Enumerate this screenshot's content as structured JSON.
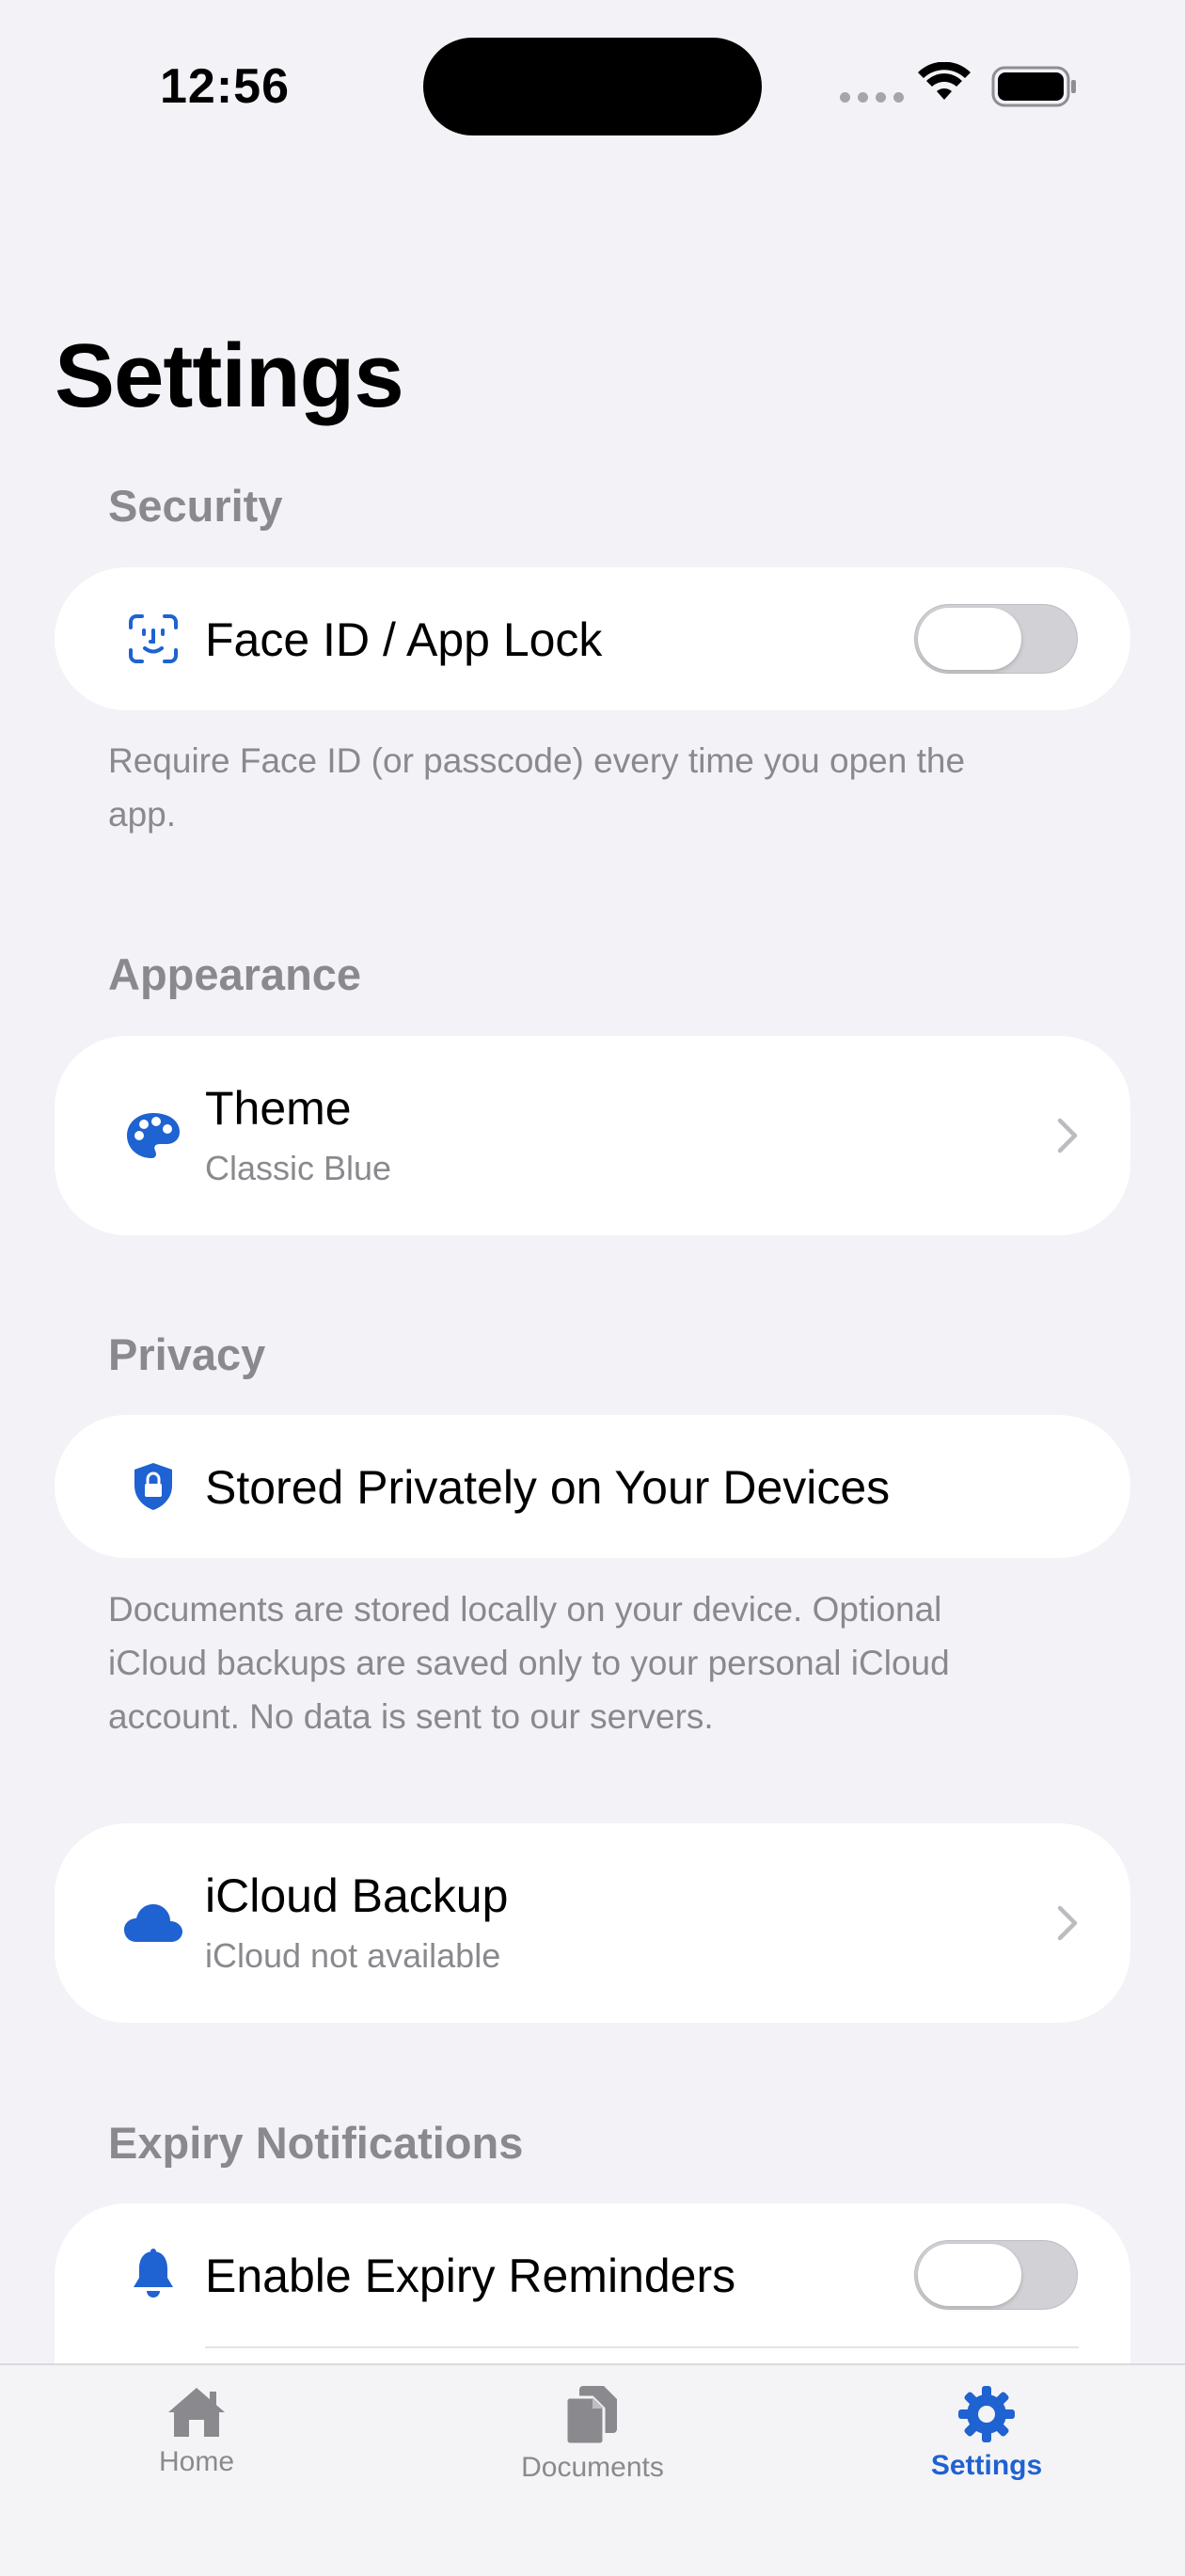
{
  "status_bar": {
    "time": "12:56"
  },
  "page_title": "Settings",
  "sections": {
    "security": {
      "header": "Security",
      "face_id_label": "Face ID / App Lock",
      "face_id_enabled": false,
      "footer": "Require Face ID (or passcode) every time you open the app."
    },
    "appearance": {
      "header": "Appearance",
      "theme_label": "Theme",
      "theme_value": "Classic Blue"
    },
    "privacy": {
      "header": "Privacy",
      "stored_label": "Stored Privately on Your Devices",
      "footer": "Documents are stored locally on your device. Optional iCloud backups are saved only to your personal iCloud account. No data is sent to our servers.",
      "icloud_label": "iCloud Backup",
      "icloud_status": "iCloud not available"
    },
    "expiry": {
      "header": "Expiry Notifications",
      "reminders_label": "Enable Expiry Reminders",
      "reminders_enabled": false
    }
  },
  "tabbar": {
    "home": "Home",
    "documents": "Documents",
    "settings": "Settings",
    "active": "settings"
  },
  "colors": {
    "accent": "#1F62D1",
    "background": "#F2F2F7",
    "secondary_text": "#8A8A8E"
  }
}
